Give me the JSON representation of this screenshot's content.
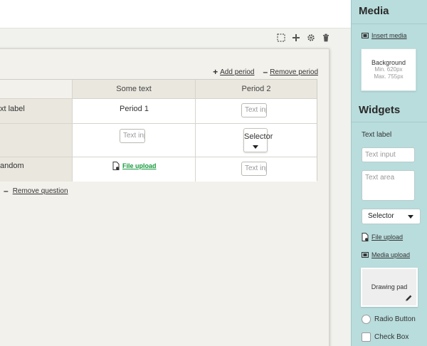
{
  "canvas": {
    "add_period": "Add period",
    "remove_period": "Remove period",
    "header_col_a": "Some text",
    "header_col_b": "Period 2",
    "row1_label": "xt label",
    "row1_col_a_text": "Period 1",
    "row1_col_b_placeholder": "Text input",
    "row2_col_a_placeholder": "Text input",
    "row2_selector_label": "Selector",
    "row3_label": "andom",
    "row3_file_upload": "File upload",
    "row3_col_b_placeholder": "Text input",
    "remove_question": "Remove question"
  },
  "toolbar": {
    "icons": [
      "select-icon",
      "add-icon",
      "settings-icon",
      "trash-icon"
    ]
  },
  "sidebar": {
    "media_title": "Media",
    "insert_media": "Insert media",
    "background_title": "Background",
    "background_min": "Min. 620px",
    "background_max": "Max. 755px",
    "widgets_title": "Widgets",
    "text_label": "Text label",
    "text_input_placeholder": "Text input",
    "text_area_placeholder": "Text area",
    "selector_label": "Selector",
    "file_upload": "File upload",
    "media_upload": "Media upload",
    "drawing_pad": "Drawing pad",
    "radio_button": "Radio Button",
    "check_box": "Check Box"
  },
  "colors": {
    "sidebar_bg": "#b9dcdc",
    "canvas_bg": "#f3f1ec",
    "link_green": "#159a3b"
  }
}
